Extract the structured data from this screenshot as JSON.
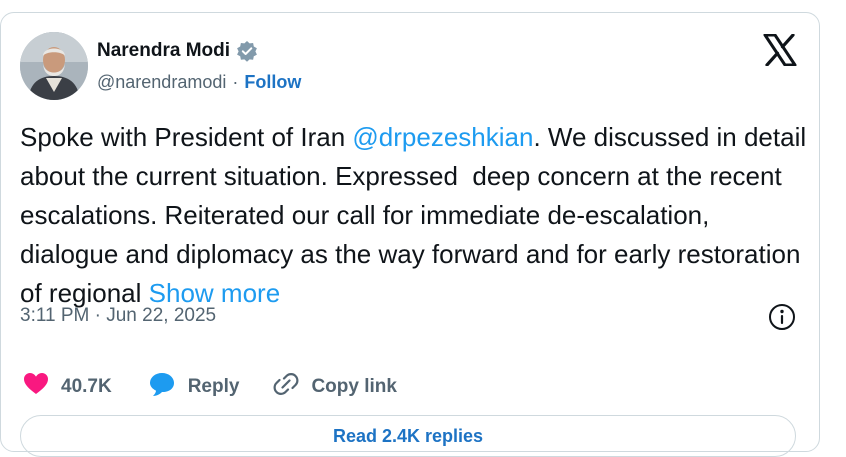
{
  "author": {
    "name": "Narendra Modi",
    "handle": "@narendramodi",
    "separator": "·",
    "follow_label": "Follow"
  },
  "tweet": {
    "text_before": "Spoke with President of Iran ",
    "mention": "@drpezeshkian",
    "text_after": ". We discussed in detail about the current situation. Expressed  deep concern at the recent escalations. Reiterated our call for immediate de-escalation, dialogue and diplomacy as the way forward and for early restoration of regional ",
    "show_more": "Show more",
    "timestamp": "3:11 PM · Jun 22, 2025"
  },
  "actions": {
    "likes": "40.7K",
    "reply_label": "Reply",
    "copy_link_label": "Copy link"
  },
  "read_replies_label": "Read 2.4K replies",
  "icons": {
    "verified": "verified-badge-icon",
    "x_logo": "x-logo-icon",
    "info": "info-icon",
    "heart": "heart-icon",
    "reply": "reply-bubble-icon",
    "link": "link-icon"
  },
  "colors": {
    "link": "#1d9bf0",
    "follow": "#1d73c4",
    "heart": "#f91880",
    "secondary_text": "#536471",
    "border": "#cfd9de"
  }
}
